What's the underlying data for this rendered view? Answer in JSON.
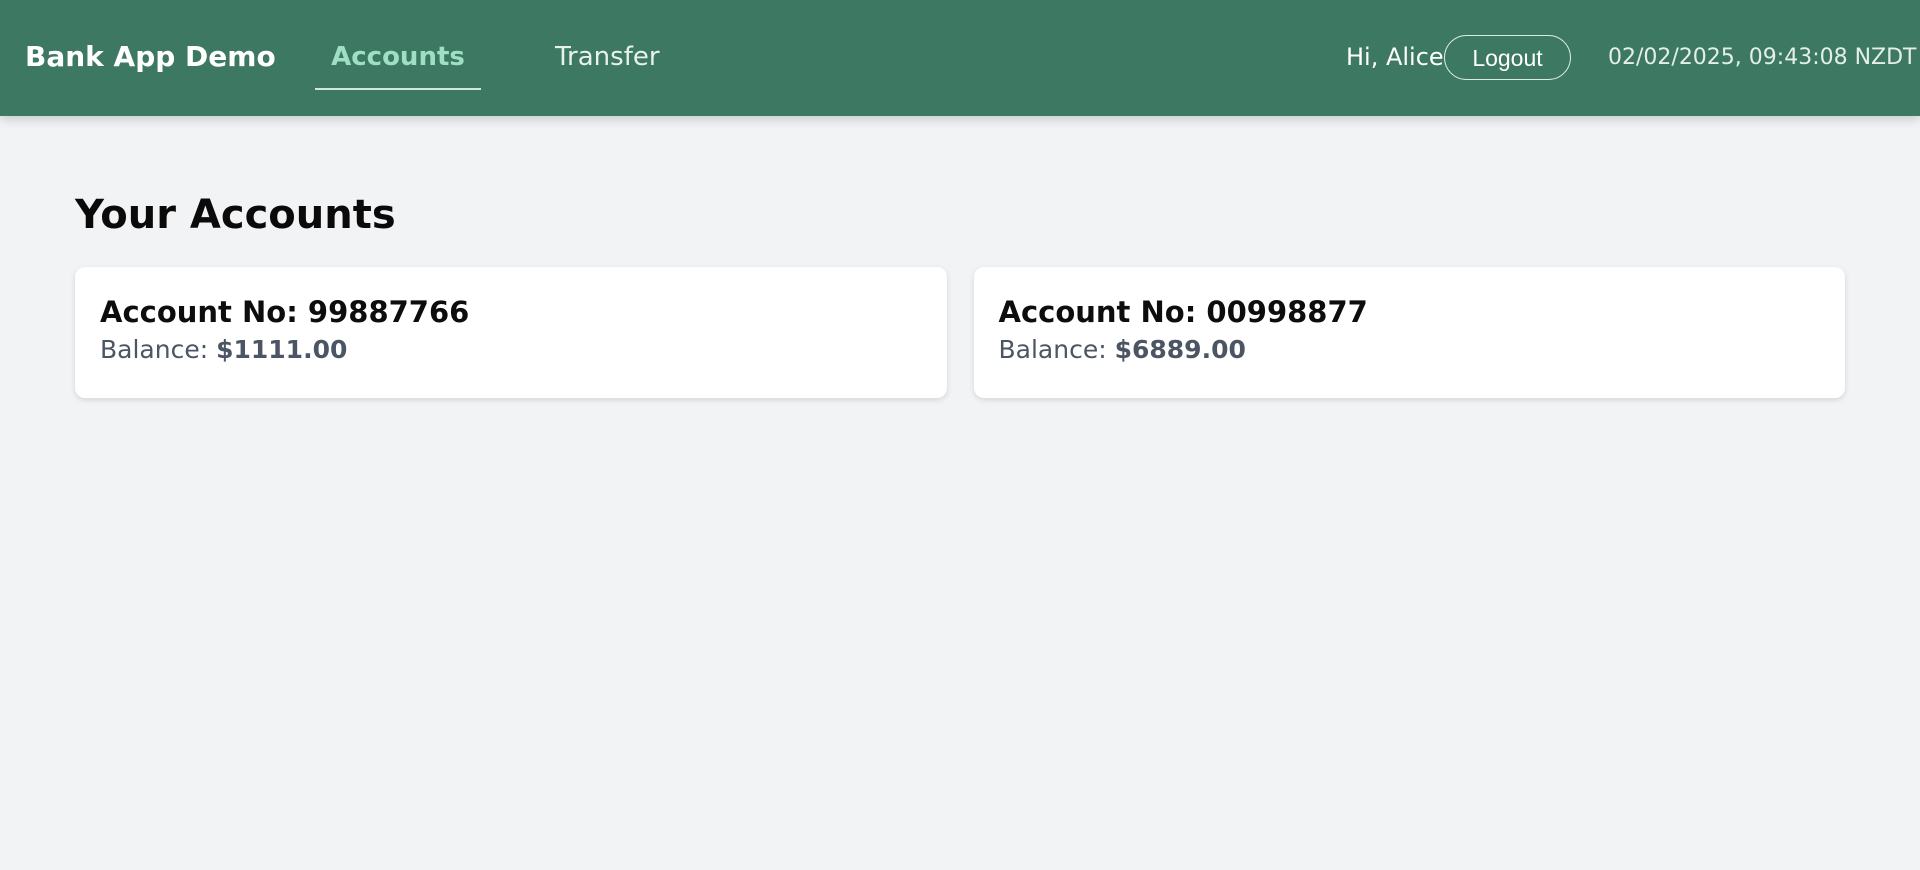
{
  "header": {
    "brand": "Bank App Demo",
    "tabs": [
      {
        "label": "Accounts",
        "active": true
      },
      {
        "label": "Transfer",
        "active": false
      }
    ],
    "greeting": "Hi, Alice",
    "logout_label": "Logout",
    "datetime": "02/02/2025, 09:43:08 NZDT",
    "colors": {
      "bar": "#3c7862",
      "active_tab": "#9fe0c4"
    }
  },
  "main": {
    "title": "Your Accounts",
    "accounts": [
      {
        "account_label": "Account No:",
        "account_no": "99887766",
        "balance_label": "Balance:",
        "balance": "$1111.00"
      },
      {
        "account_label": "Account No:",
        "account_no": "00998877",
        "balance_label": "Balance:",
        "balance": "$6889.00"
      }
    ]
  }
}
